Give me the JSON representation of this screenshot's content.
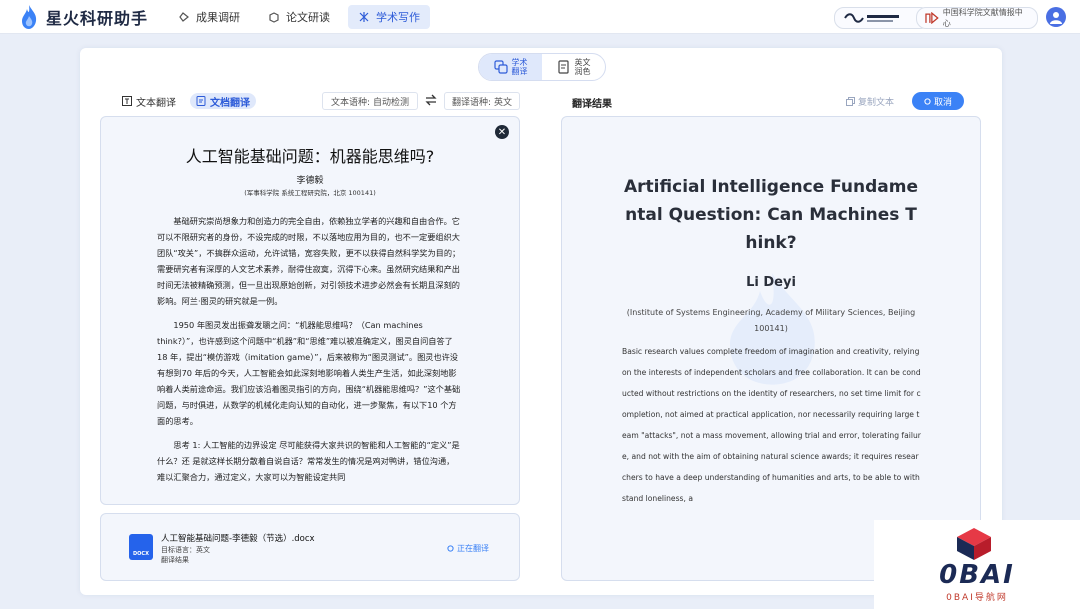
{
  "app": {
    "title": "星火科研助手"
  },
  "nav": [
    {
      "label": "成果调研",
      "icon": "compass-icon"
    },
    {
      "label": "论文研读",
      "icon": "book-icon"
    },
    {
      "label": "学术写作",
      "icon": "pen-icon",
      "active": true
    }
  ],
  "partners": [
    {
      "label": "中国科学院文献情报中心"
    }
  ],
  "modes": [
    {
      "line1": "学术",
      "line2": "翻译",
      "active": true
    },
    {
      "line1": "英文",
      "line2": "润色"
    }
  ],
  "tabs": [
    {
      "label": "文本翻译"
    },
    {
      "label": "文档翻译",
      "active": true
    }
  ],
  "source_lang": "文本语种: 自动检测",
  "target_lang": "翻译语种: 英文",
  "result_title": "翻译结果",
  "copy_label": "复制文本",
  "cancel_label": "取消",
  "source": {
    "title": "人工智能基础问题：机器能思维吗?",
    "author": "李德毅",
    "affiliation": "(军事科学院 系统工程研究院，北京 100141)",
    "paragraphs": [
      "基础研究崇尚想象力和创造力的完全自由，依赖独立学者的兴趣和自由合作。它可以不限研究者的身份，不设完成的时限，不以落地应用为目的，也不一定要组织大团队“攻关”，不搞群众运动，允许试错，宽容失败，更不以获得自然科学奖为目的；需要研究者有深厚的人文艺术素养，耐得住寂寞，沉得下心来。虽然研究结果和产出时间无法被精确预测，但一旦出现原始创新，对引领技术进步必然会有长期且深刻的影响。阿兰·图灵的研究就是一例。",
      "1950 年图灵发出振聋发聩之问：“机器能思维吗？（Can machines think?）”，也许感到这个问题中“机器”和“思维”难以被准确定义，图灵自问自答了 18 年，提出“模仿游戏（imitation game）”，后来被称为“图灵测试”。图灵也许没有想到70 年后的今天，人工智能会如此深刻地影响着人类生产生活，如此深刻地影响着人类前途命运。我们应该沿着图灵指引的方向，围绕“机器能思维吗？”这个基础问题，与时俱进，从数学的机械化走向认知的自动化，进一步聚焦，有以下10 个方面的思考。",
      "思考 1: 人工智能的边界设定 尽可能获得大家共识的智能和人工智能的“定义”是什么？还 是就这样长期分散着自说自话？常常发生的情况是鸡对鸭讲，错位沟通，难以汇聚合力，通过定义，大家可以为智能设定共同"
    ]
  },
  "file": {
    "name": "人工智能基础问题-李德毅（节选）.docx",
    "target": "目标语言：英文",
    "result": "翻译结果",
    "status": "正在翻译",
    "type_label": "DOCX"
  },
  "result": {
    "title": "Artificial Intelligence Fundamental Question: Can Machines Think?",
    "author": "Li Deyi",
    "affiliation": "(Institute of Systems Engineering, Academy of Military Sciences, Beijing 100141)",
    "body": "Basic research values complete freedom of imagination and creativity, relying on the interests of independent scholars and free collaboration. It can be conducted without restrictions on the identity of researchers, no set time limit for completion, not aimed at practical application, nor necessarily requiring large team \"attacks\", not a mass movement, allowing trial and error, tolerating failure, and not with the aim of obtaining natural science awards; it requires researchers to have a deep understanding of humanities and arts, to be able to withstand loneliness, a"
  },
  "watermark": {
    "big": "0BAI",
    "small": "0BAI导航网"
  },
  "colors": {
    "accent": "#3b82f6",
    "active_bg": "#dfe8fb",
    "panel_bg": "#f3f6fc"
  }
}
